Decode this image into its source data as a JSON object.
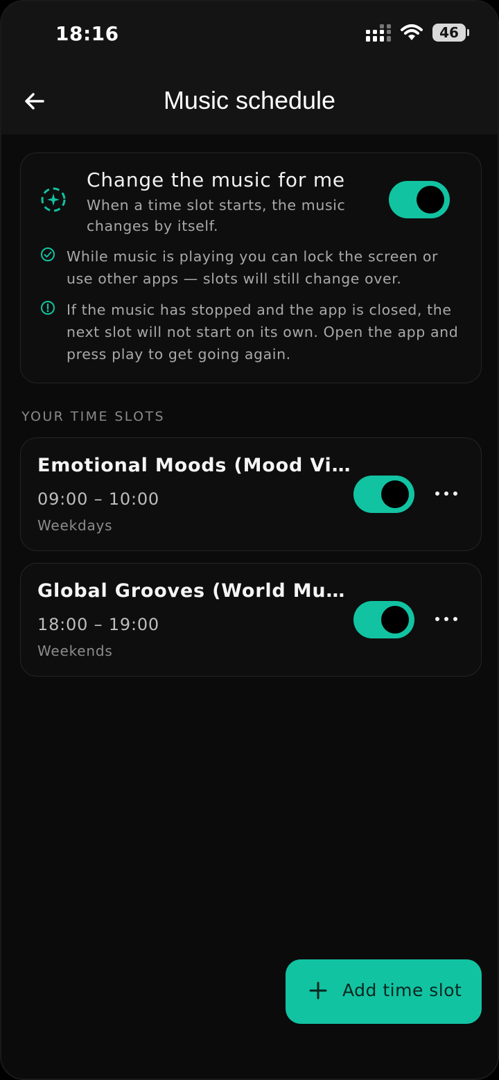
{
  "status_bar": {
    "time": "18:16",
    "battery": "46"
  },
  "header": {
    "title": "Music schedule"
  },
  "auto_change": {
    "title": "Change the music for me",
    "description": "When a time slot starts, the music changes by itself.",
    "enabled": true,
    "notes": [
      {
        "icon": "check-circle-icon",
        "text": "While music is playing you can lock the screen or use other apps — slots will still change over."
      },
      {
        "icon": "info-circle-icon",
        "text": "If the music has stopped and the app is closed, the next slot will not start on its own. Open the app and press play to get going again."
      }
    ]
  },
  "time_slots": {
    "section_label": "YOUR TIME SLOTS",
    "items": [
      {
        "name": "Emotional Moods (Mood Vi…",
        "time": "09:00 – 10:00",
        "days": "Weekdays",
        "enabled": true
      },
      {
        "name": "Global Grooves (World Mus…",
        "time": "18:00 – 19:00",
        "days": "Weekends",
        "enabled": true
      }
    ]
  },
  "add_button": {
    "label": "Add time slot"
  },
  "colors": {
    "accent": "#12c3a2",
    "background": "#0b0b0b",
    "card_border": "#252525"
  }
}
